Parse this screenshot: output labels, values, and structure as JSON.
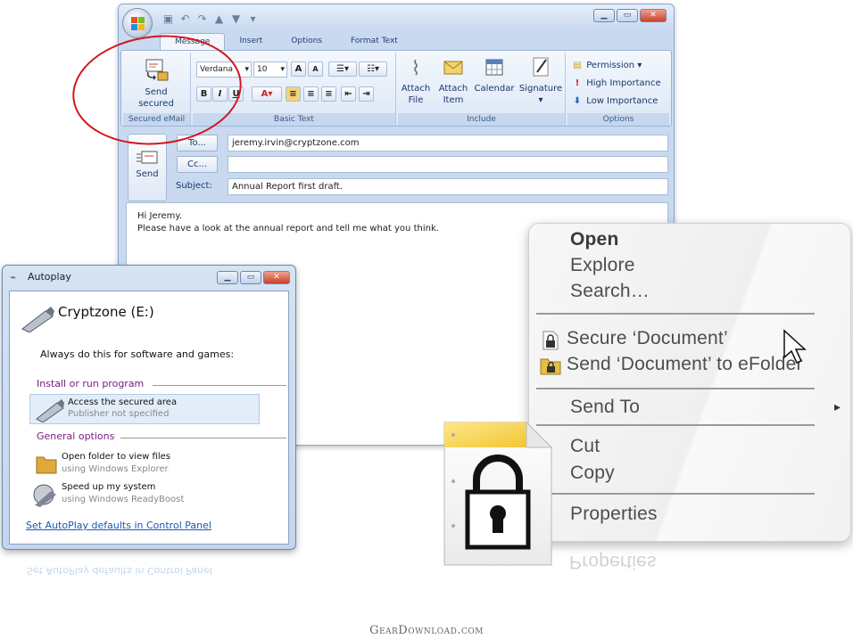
{
  "outlook": {
    "tabs": [
      "Message",
      "Insert",
      "Options",
      "Format Text"
    ],
    "ribbon": {
      "secured_group": {
        "button_line1": "Send",
        "button_line2": "secured",
        "label": "Secured eMail"
      },
      "basic_text": {
        "font": "Verdana",
        "size": "10",
        "label": "Basic Text"
      },
      "include": {
        "attach_file": [
          "Attach",
          "File"
        ],
        "attach_item": [
          "Attach",
          "Item"
        ],
        "calendar": "Calendar",
        "signature": "Signature",
        "label": "Include"
      },
      "options": {
        "permission": "Permission",
        "high": "High Importance",
        "low": "Low Importance",
        "label": "Options"
      }
    },
    "send_label": "Send",
    "to_label": "To...",
    "cc_label": "Cc...",
    "subject_label": "Subject:",
    "to_value": "jeremy.irvin@cryptzone.com",
    "cc_value": "",
    "subject_value": "Annual Report first draft.",
    "body_line1": "Hi Jeremy.",
    "body_line2": "Please have a look at the annual report and tell me what you think."
  },
  "autoplay": {
    "title": "Autoplay",
    "drive": "Cryptzone (E:)",
    "always": "Always do this for software and games:",
    "section1": "Install or run program",
    "item1_title": "Access the secured area",
    "item1_sub": "Publisher not specified",
    "section2": "General options",
    "item2_title": "Open folder to view files",
    "item2_sub": "using Windows Explorer",
    "item3_title": "Speed up my system",
    "item3_sub": "using Windows ReadyBoost",
    "link": "Set AutoPlay defaults in Control Panel"
  },
  "context_menu": {
    "open": "Open",
    "explore": "Explore",
    "search": "Search…",
    "secure": "Secure ‘Document’",
    "send_efolder": "Send ‘Document’ to eFolder",
    "send_to": "Send To",
    "cut": "Cut",
    "copy": "Copy",
    "properties": "Properties"
  },
  "watermark": "GearDownload.com",
  "colors": {
    "annotation_circle": "#d2171f",
    "section_text": "#7a1e82",
    "link": "#1a56b0"
  }
}
